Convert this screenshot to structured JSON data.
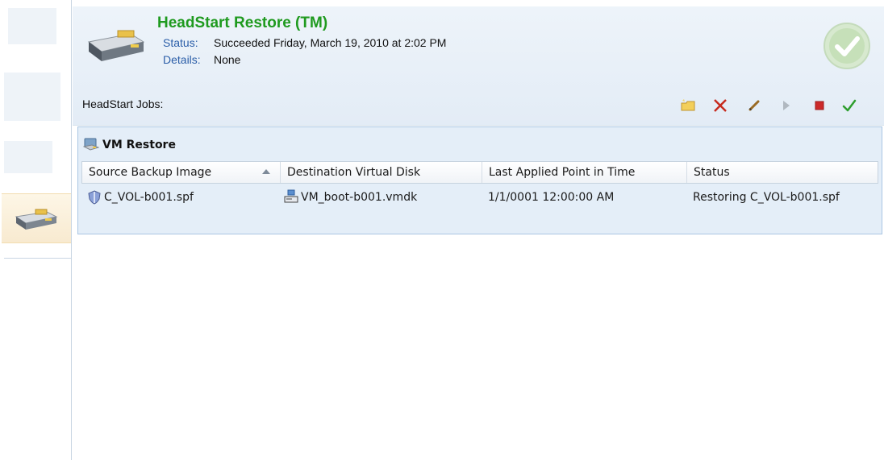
{
  "header": {
    "title": "HeadStart Restore (TM)",
    "status_key": "Status:",
    "status_value": "Succeeded Friday, March 19, 2010 at 2:02 PM",
    "details_key": "Details:",
    "details_value": "None",
    "jobs_label": "HeadStart Jobs:",
    "status_indicator_icon": "check-circle-icon"
  },
  "toolbar": {
    "items": [
      {
        "icon": "new-folder-icon",
        "color": "#e0b33c"
      },
      {
        "icon": "delete-icon",
        "color": "#c62b1f"
      },
      {
        "icon": "edit-pencil-icon",
        "color": "#9a6b25"
      },
      {
        "icon": "play-icon",
        "color": "#b0b8c0"
      },
      {
        "icon": "stop-icon",
        "color": "#cc2a2a"
      },
      {
        "icon": "checkmark-icon",
        "color": "#2e9e2e"
      }
    ]
  },
  "panel": {
    "title": "VM Restore",
    "columns": [
      "Source Backup Image",
      "Destination Virtual Disk",
      "Last Applied Point in Time",
      "Status"
    ],
    "rows": [
      {
        "source": "C_VOL-b001.spf",
        "destination": "VM_boot-b001.vmdk",
        "last_applied": "1/1/0001 12:00:00 AM",
        "status": "Restoring C_VOL-b001.spf"
      }
    ]
  },
  "colors": {
    "title_green": "#1f9a1f",
    "label_blue": "#2b5ea8",
    "panel_bg": "#e4eef8"
  }
}
